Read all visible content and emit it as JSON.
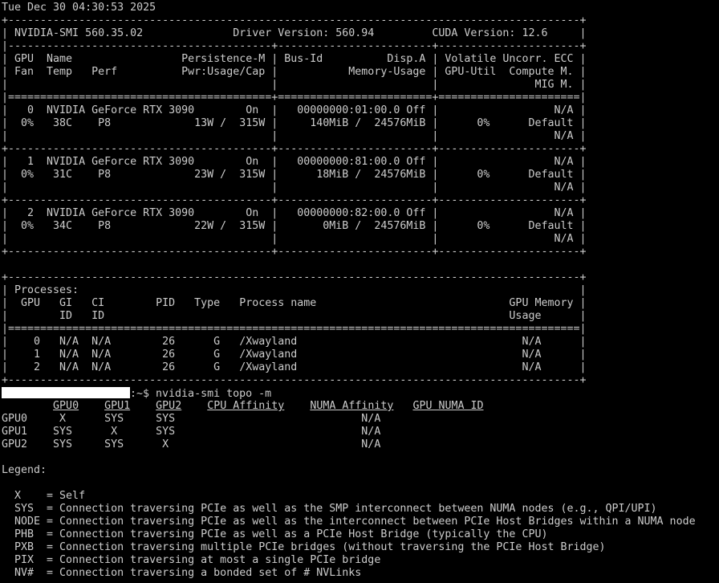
{
  "terminal": {
    "date_line": "Tue Dec 30 04:30:53 2025",
    "smi": [
      "+-----------------------------------------------------------------------------------------+",
      "| NVIDIA-SMI 560.35.02              Driver Version: 560.94         CUDA Version: 12.6     |",
      "|-----------------------------------------+------------------------+----------------------+",
      "| GPU  Name                 Persistence-M | Bus-Id          Disp.A | Volatile Uncorr. ECC |",
      "| Fan  Temp   Perf          Pwr:Usage/Cap |           Memory-Usage | GPU-Util  Compute M. |",
      "|                                         |                        |               MIG M. |",
      "|=========================================+========================+======================|",
      "|   0  NVIDIA GeForce RTX 3090        On  |   00000000:01:00.0 Off |                  N/A |",
      "|  0%   38C    P8             13W /  315W |     140MiB /  24576MiB |      0%      Default |",
      "|                                         |                        |                  N/A |",
      "+-----------------------------------------+------------------------+----------------------+",
      "|   1  NVIDIA GeForce RTX 3090        On  |   00000000:81:00.0 Off |                  N/A |",
      "|  0%   31C    P8             23W /  315W |      18MiB /  24576MiB |      0%      Default |",
      "|                                         |                        |                  N/A |",
      "+-----------------------------------------+------------------------+----------------------+",
      "|   2  NVIDIA GeForce RTX 3090        On  |   00000000:82:00.0 Off |                  N/A |",
      "|  0%   34C    P8             22W /  315W |       0MiB /  24576MiB |      0%      Default |",
      "|                                         |                        |                  N/A |",
      "+-----------------------------------------+------------------------+----------------------+",
      "",
      "+-----------------------------------------------------------------------------------------+",
      "| Processes:                                                                              |",
      "|  GPU   GI   CI        PID   Type   Process name                              GPU Memory |",
      "|        ID   ID                                                               Usage      |",
      "|=========================================================================================|",
      "|    0   N/A  N/A        26      G   /Xwayland                                   N/A      |",
      "|    1   N/A  N/A        26      G   /Xwayland                                   N/A      |",
      "|    2   N/A  N/A        26      G   /Xwayland                                   N/A      |",
      "+-----------------------------------------------------------------------------------------+"
    ],
    "prompt_suffix": ":~$ ",
    "command": "nvidia-smi topo -m",
    "topo_headers": [
      "GPU0",
      "GPU1",
      "GPU2",
      "CPU Affinity",
      "NUMA Affinity",
      "GPU NUMA ID"
    ],
    "topo_rows": [
      "GPU0     X      SYS     SYS                             N/A",
      "GPU1    SYS      X      SYS                             N/A",
      "GPU2    SYS     SYS      X                              N/A"
    ],
    "legend_title": "Legend:",
    "legend": [
      "  X    = Self",
      "  SYS  = Connection traversing PCIe as well as the SMP interconnect between NUMA nodes (e.g., QPI/UPI)",
      "  NODE = Connection traversing PCIe as well as the interconnect between PCIe Host Bridges within a NUMA node",
      "  PHB  = Connection traversing PCIe as well as a PCIe Host Bridge (typically the CPU)",
      "  PXB  = Connection traversing multiple PCIe bridges (without traversing the PCIe Host Bridge)",
      "  PIX  = Connection traversing at most a single PCIe bridge",
      "  NV#  = Connection traversing a bonded set of # NVLinks"
    ]
  }
}
